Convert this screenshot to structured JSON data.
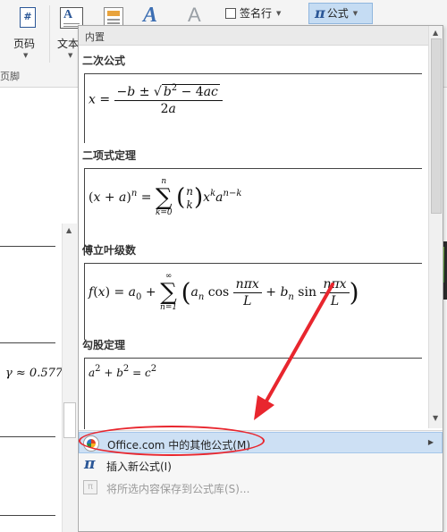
{
  "ribbon": {
    "page_number_icon": "#",
    "page_number_label": "页码",
    "textbox_label": "文本",
    "signature_label": "签名行",
    "equation_symbol": "π",
    "equation_label": "公式",
    "group_label": "页脚"
  },
  "document": {
    "formula_fragment": "γ ≈ 0.577"
  },
  "gallery": {
    "header": "内置",
    "equations": [
      {
        "title": "二次公式"
      },
      {
        "title": "二项式定理"
      },
      {
        "title": "傅立叶级数"
      },
      {
        "title": "勾股定理"
      }
    ],
    "menu": {
      "office_more": "Office.com 中的其他公式(M)",
      "insert_new": "插入新公式(I)",
      "save_selection": "将所选内容保存到公式库(S)..."
    }
  },
  "colors": {
    "annotation": "#e8262e",
    "hover_highlight": "#cde0f4",
    "equation_button_active": "#c5dcf3"
  },
  "icons": {
    "office": "office-logo-icon",
    "insert": "pi-icon",
    "save": "save-to-gallery-icon"
  }
}
